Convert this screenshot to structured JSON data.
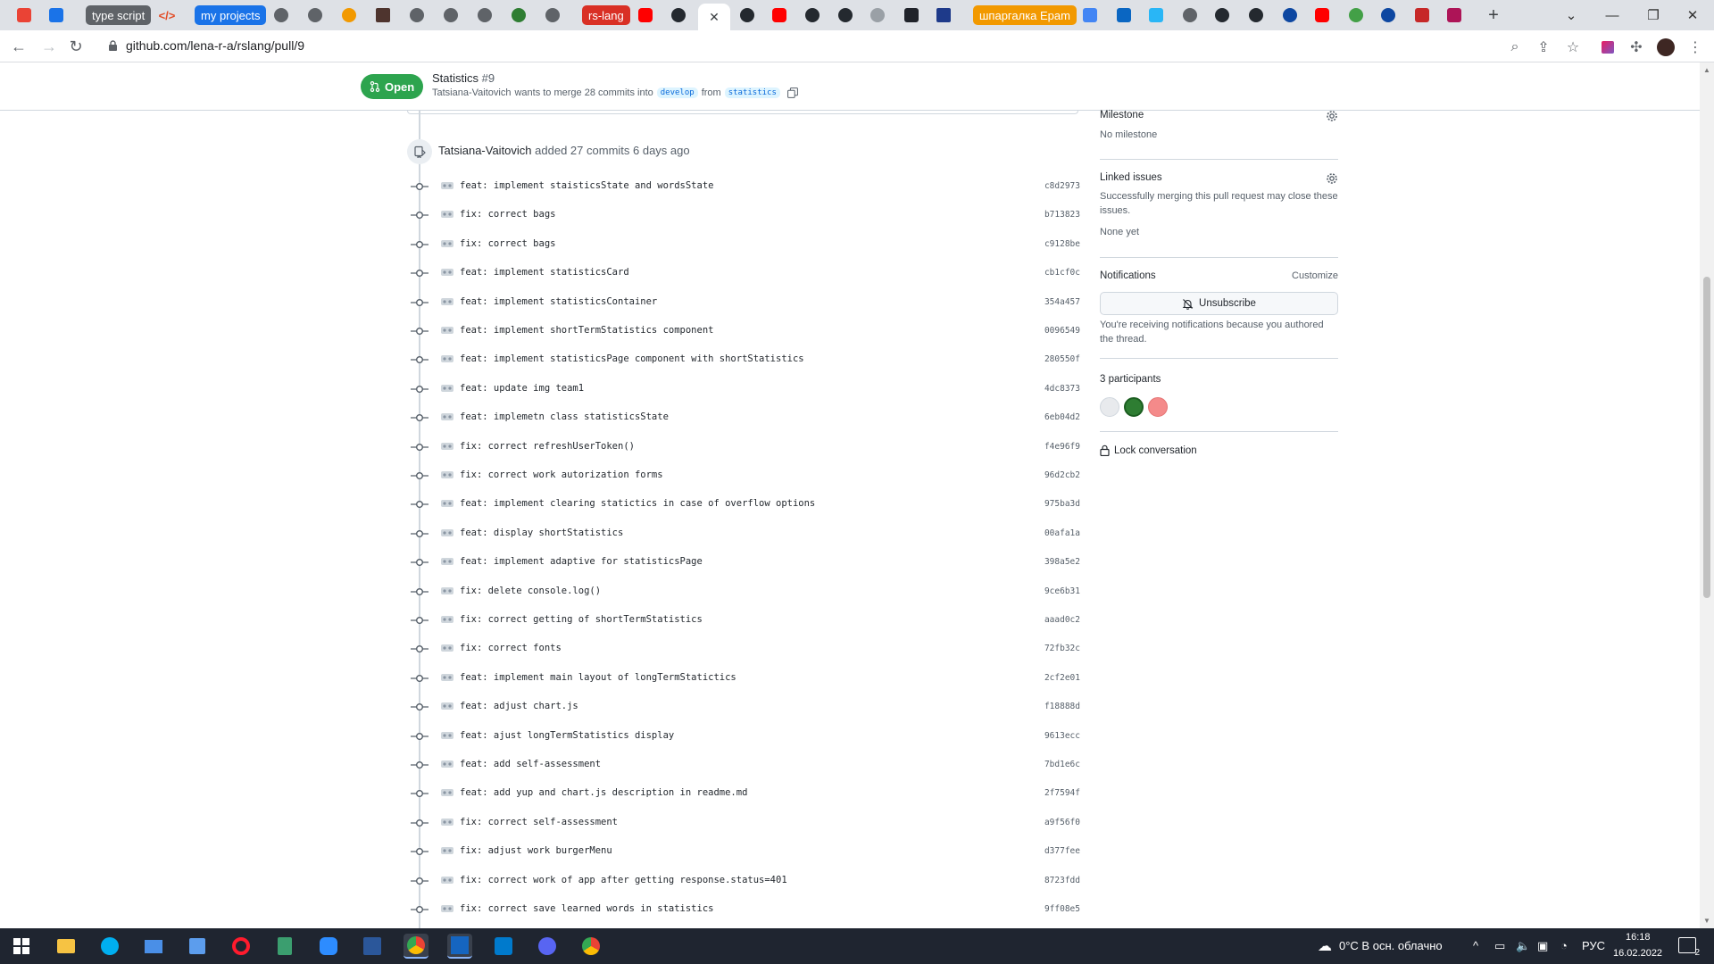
{
  "browser": {
    "tabs": [
      {
        "kind": "favicon",
        "icon": "gmail-icon",
        "color": "#ea4335"
      },
      {
        "kind": "favicon",
        "icon": "z-icon",
        "color": "#1a73e8"
      },
      {
        "kind": "pill",
        "label": "type script",
        "color": "#5f6368"
      },
      {
        "kind": "favicon",
        "icon": "code-icon",
        "color": "#e34c26"
      },
      {
        "kind": "pill",
        "label": "my projects",
        "color": "#1a73e8"
      },
      {
        "kind": "pill",
        "label": "rs-lang",
        "color": "#d93025"
      },
      {
        "kind": "pill",
        "label": "шпаргалка Epam",
        "color": "#f29900"
      }
    ],
    "new_tab_label": "+",
    "url": "github.com/lena-r-a/rslang/pull/9"
  },
  "pr": {
    "state": "Open",
    "title": "Statistics",
    "number": "#9",
    "author": "Tatsiana-Vaitovich",
    "merge_text": "wants to merge 28 commits into",
    "base_branch": "develop",
    "from_text": "from",
    "head_branch": "statistics"
  },
  "push_event": {
    "author": "Tatsiana-Vaitovich",
    "text": "added 27 commits 6 days ago"
  },
  "commits": [
    {
      "message": "feat: implement staisticsState and wordsState",
      "sha": "c8d2973"
    },
    {
      "message": "fix: correct bags",
      "sha": "b713823"
    },
    {
      "message": "fix: correct bags",
      "sha": "c9128be"
    },
    {
      "message": "feat: implement statisticsCard",
      "sha": "cb1cf0c"
    },
    {
      "message": "feat: implement statisticsContainer",
      "sha": "354a457"
    },
    {
      "message": "feat: implement shortTermStatistics component",
      "sha": "0096549"
    },
    {
      "message": "feat: implement statisticsPage component with shortStatistics",
      "sha": "280550f"
    },
    {
      "message": "feat: update img team1",
      "sha": "4dc8373"
    },
    {
      "message": "feat: implemetn class statisticsState",
      "sha": "6eb04d2"
    },
    {
      "message": "fix: correct refreshUserToken()",
      "sha": "f4e96f9"
    },
    {
      "message": "fix: correct work autorization forms",
      "sha": "96d2cb2"
    },
    {
      "message": "feat: implement clearing statictics in case of overflow options",
      "sha": "975ba3d"
    },
    {
      "message": "feat: display shortStatistics",
      "sha": "00afa1a"
    },
    {
      "message": "feat: implement adaptive for statisticsPage",
      "sha": "398a5e2"
    },
    {
      "message": "fix: delete console.log()",
      "sha": "9ce6b31"
    },
    {
      "message": "fix: correct getting of shortTermStatistics",
      "sha": "aaad0c2"
    },
    {
      "message": "fix: correct fonts",
      "sha": "72fb32c"
    },
    {
      "message": "feat: implement main layout of longTermStatictics",
      "sha": "2cf2e01"
    },
    {
      "message": "feat: adjust chart.js",
      "sha": "f18888d"
    },
    {
      "message": "feat: ajust longTermStatistics display",
      "sha": "9613ecc"
    },
    {
      "message": "feat: add self-assessment",
      "sha": "7bd1e6c"
    },
    {
      "message": "feat: add yup and chart.js description in readme.md",
      "sha": "2f7594f"
    },
    {
      "message": "fix: correct self-assessment",
      "sha": "a9f56f0"
    },
    {
      "message": "fix: adjust work burgerMenu",
      "sha": "d377fee"
    },
    {
      "message": "fix: correct work of app after getting response.status=401",
      "sha": "8723fdd"
    },
    {
      "message": "fix: correct save learned words in statistics",
      "sha": "9ff08e5"
    }
  ],
  "sidebar": {
    "milestone": {
      "heading": "Milestone",
      "value": "No milestone"
    },
    "linked_issues": {
      "heading": "Linked issues",
      "description": "Successfully merging this pull request may close these issues.",
      "value": "None yet"
    },
    "notifications": {
      "heading": "Notifications",
      "customize_label": "Customize",
      "button_label": "Unsubscribe",
      "description": "You're receiving notifications because you authored the thread."
    },
    "participants": {
      "heading": "3 participants"
    },
    "lock_label": "Lock conversation"
  },
  "taskbar": {
    "weather": "0°C  В осн. облачно",
    "language": "РУС",
    "time": "16:18",
    "date": "16.02.2022",
    "notification_count": "2"
  },
  "colors": {
    "open_green": "#2da44e",
    "link_blue": "#0969da",
    "taskbar": "#1f2530"
  }
}
